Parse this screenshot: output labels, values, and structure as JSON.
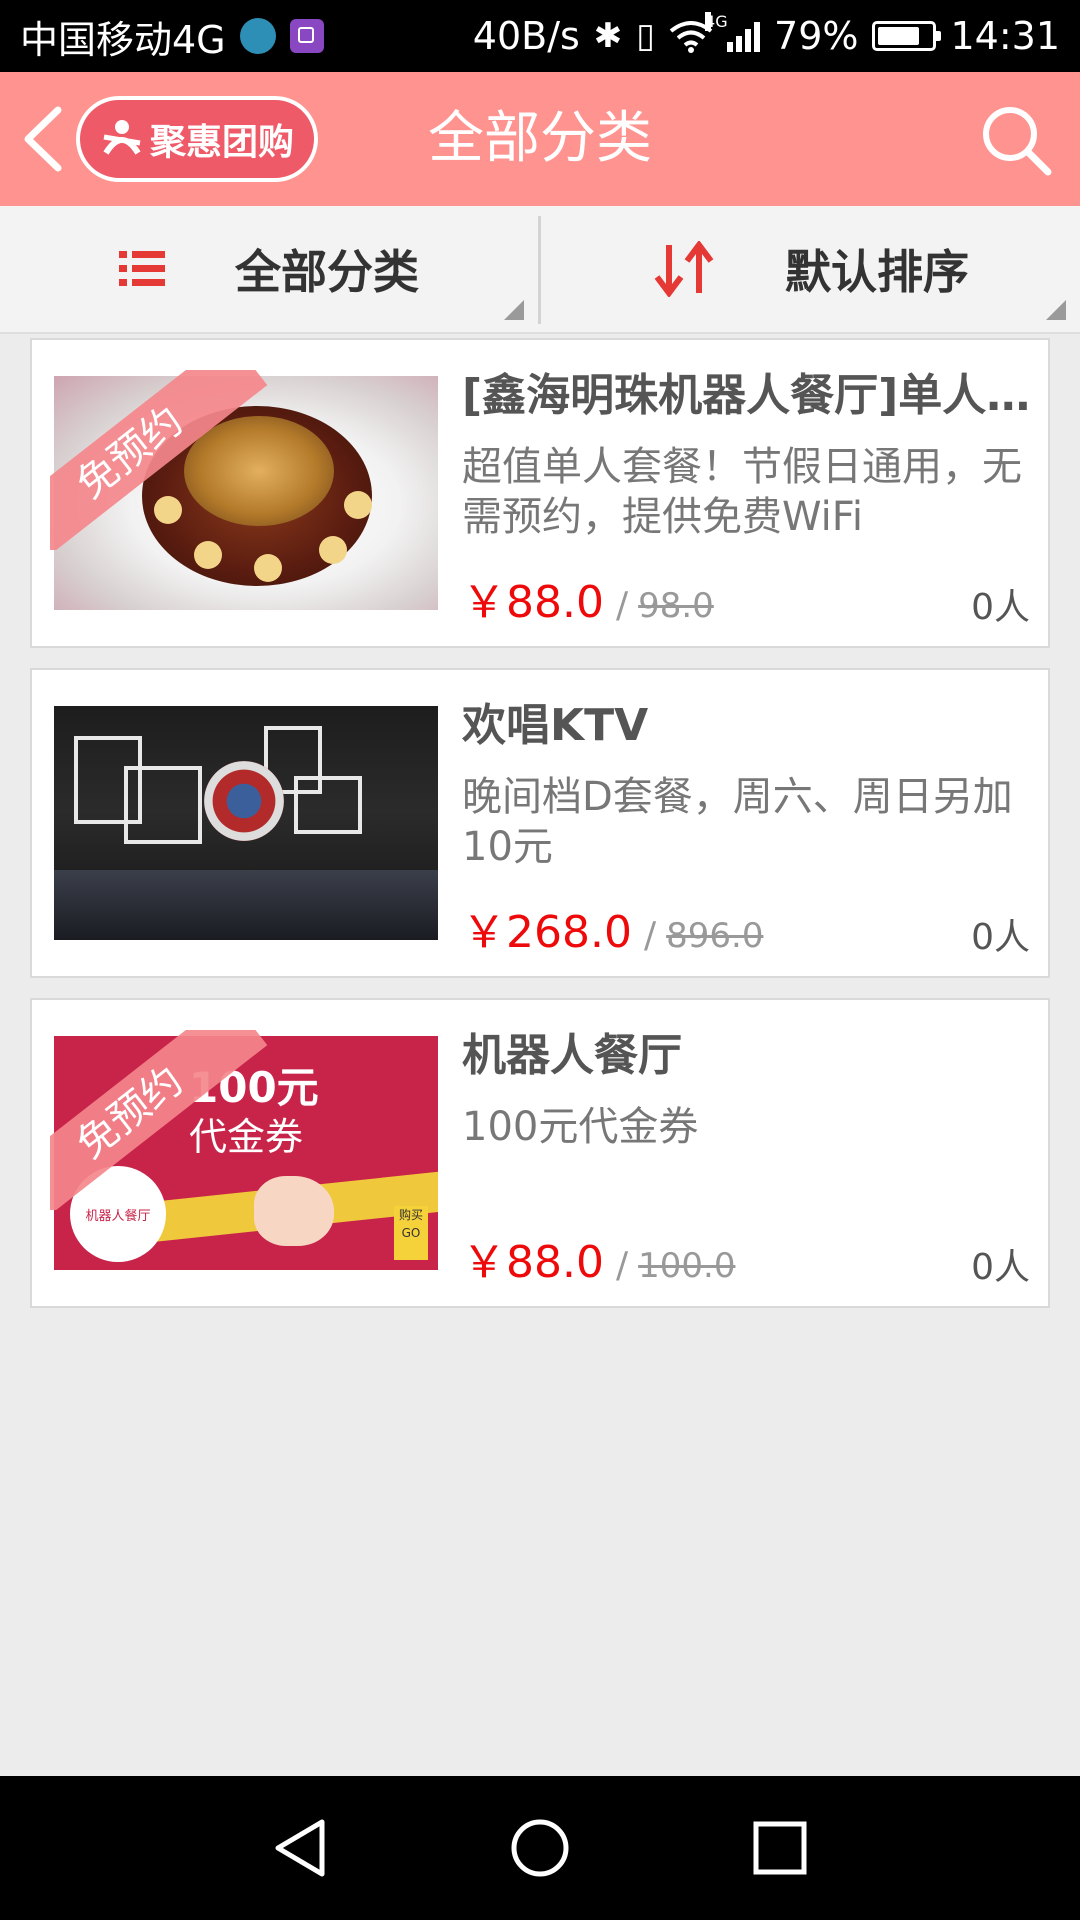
{
  "status_bar": {
    "carrier": "中国移动4G",
    "speed": "40B/s",
    "battery_percent": "79%",
    "battery_level": 0.79,
    "time": "14:31",
    "network_tag": "4G"
  },
  "header": {
    "logo_text": "聚惠团购",
    "title": "全部分类"
  },
  "filters": {
    "category_label": "全部分类",
    "sort_label": "默认排序"
  },
  "deals": [
    {
      "title": "[鑫海明珠机器人餐厅]单人套餐",
      "description": "超值单人套餐！节假日通用，无需预约，提供免费WiFi",
      "price": "￥88.0",
      "separator": "/",
      "original_price": "98.0",
      "sold": "0人",
      "badge": "免预约"
    },
    {
      "title": "欢唱KTV",
      "description": "晚间档D套餐，周六、周日另加10元",
      "price": "￥268.0",
      "separator": "/",
      "original_price": "896.0",
      "sold": "0人",
      "badge": ""
    },
    {
      "title": "机器人餐厅",
      "description": "100元代金券",
      "price": "￥88.0",
      "separator": "/",
      "original_price": "100.0",
      "sold": "0人",
      "badge": "免预约",
      "thumb_text": {
        "big": "100元",
        "sub": "代金券",
        "circle": "机器人餐厅",
        "go": "购买GO"
      }
    }
  ],
  "colors": {
    "header_bg": "#fe9390",
    "price_red": "#ee0a0a",
    "accent_red": "#e53935",
    "badge_pink": "#f4878c"
  }
}
